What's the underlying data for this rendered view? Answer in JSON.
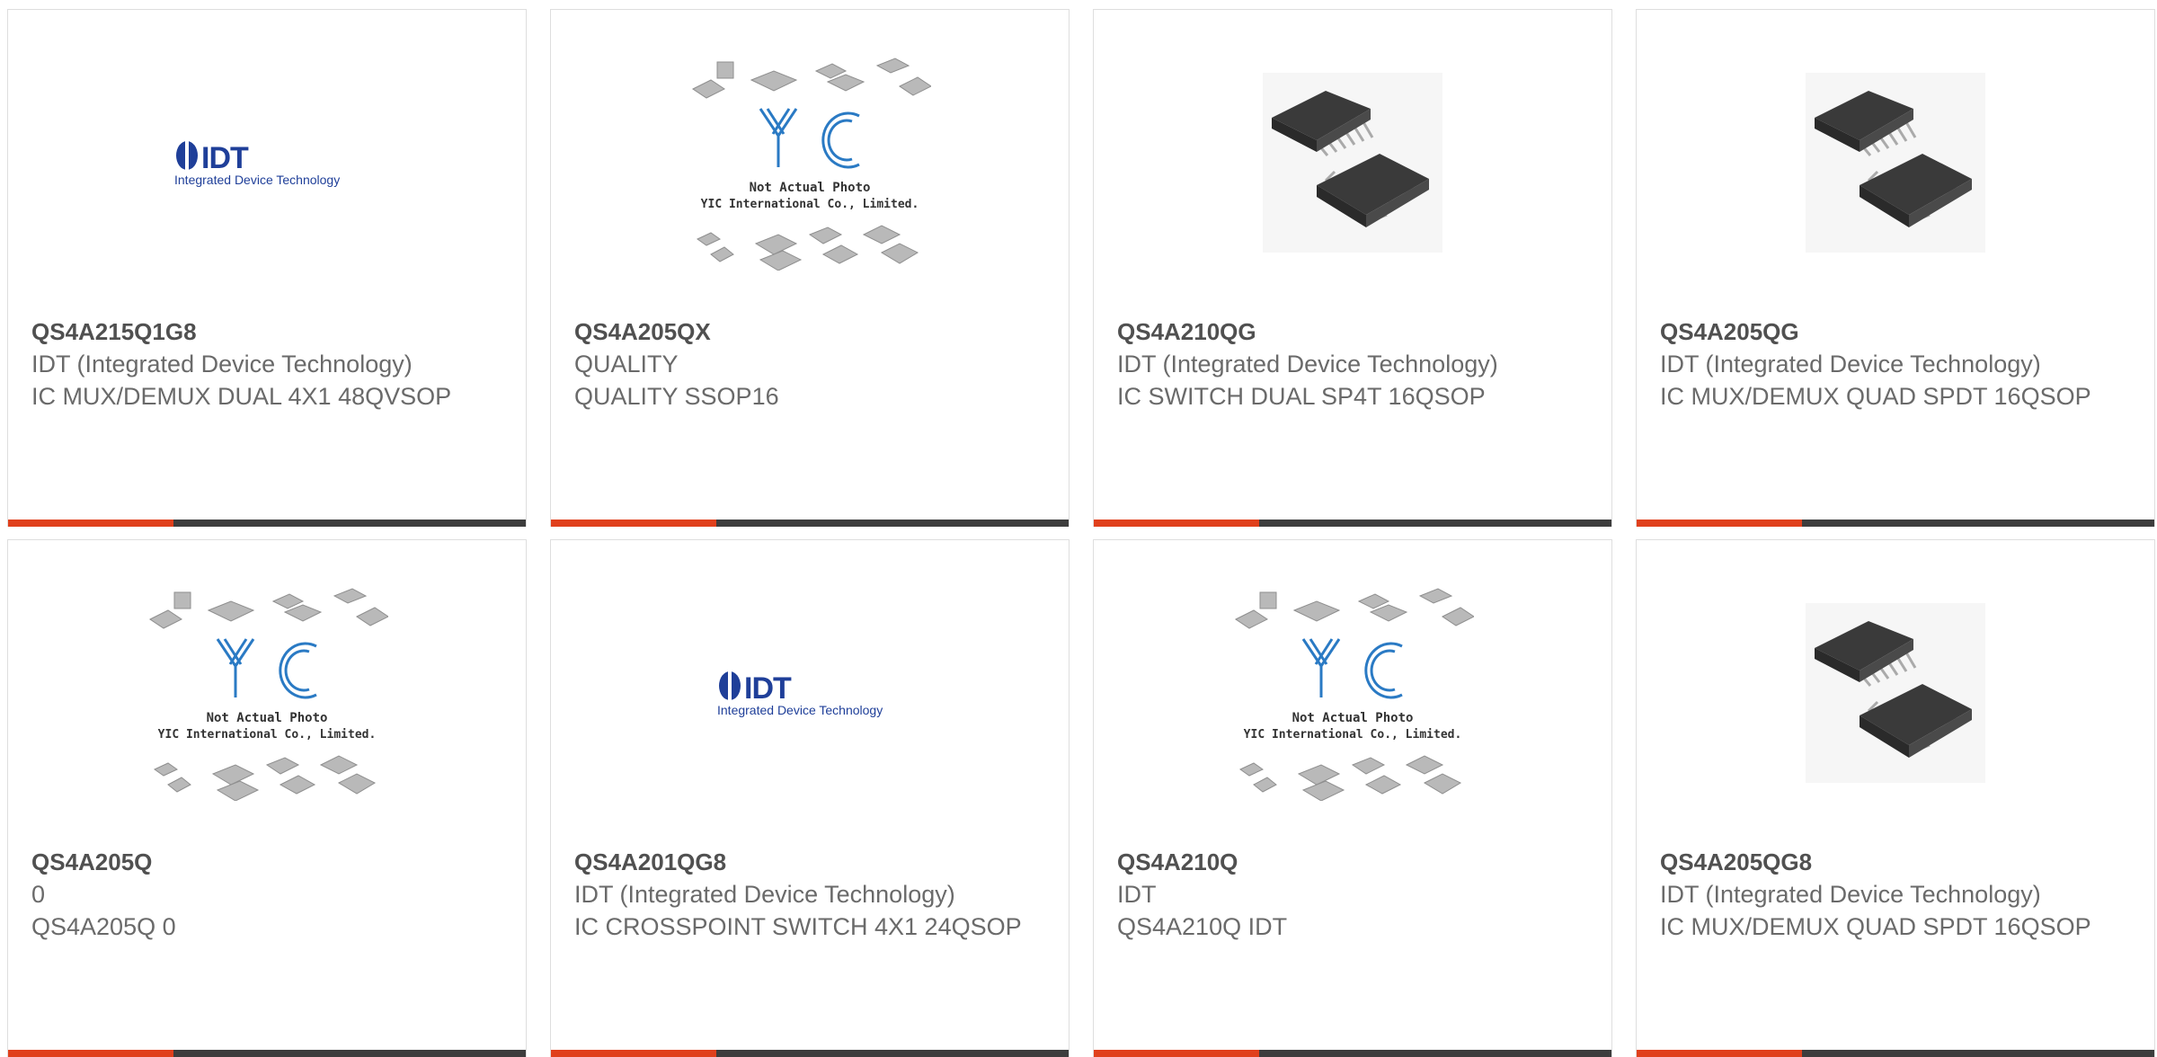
{
  "products": [
    {
      "part": "QS4A215Q1G8",
      "manufacturer": "IDT (Integrated Device Technology)",
      "description": "IC MUX/DEMUX DUAL 4X1 48QVSOP",
      "image": "idt-logo"
    },
    {
      "part": "QS4A205QX",
      "manufacturer": "QUALITY",
      "description": "QUALITY SSOP16",
      "image": "yic-placeholder"
    },
    {
      "part": "QS4A210QG",
      "manufacturer": "IDT (Integrated Device Technology)",
      "description": "IC SWITCH DUAL SP4T 16QSOP",
      "image": "ic-chip"
    },
    {
      "part": "QS4A205QG",
      "manufacturer": "IDT (Integrated Device Technology)",
      "description": "IC MUX/DEMUX QUAD SPDT 16QSOP",
      "image": "ic-chip"
    },
    {
      "part": "QS4A205Q",
      "manufacturer": "0",
      "description": "QS4A205Q 0",
      "image": "yic-placeholder"
    },
    {
      "part": "QS4A201QG8",
      "manufacturer": "IDT (Integrated Device Technology)",
      "description": "IC CROSSPOINT SWITCH 4X1 24QSOP",
      "image": "idt-logo"
    },
    {
      "part": "QS4A210Q",
      "manufacturer": "IDT",
      "description": "QS4A210Q IDT",
      "image": "yic-placeholder"
    },
    {
      "part": "QS4A205QG8",
      "manufacturer": "IDT (Integrated Device Technology)",
      "description": "IC MUX/DEMUX QUAD SPDT 16QSOP",
      "image": "ic-chip"
    }
  ],
  "logo_text": {
    "idt": "IDT",
    "idt_tagline": "Integrated Device Technology",
    "yic_line1": "Not Actual Photo",
    "yic_line2": "YIC International Co., Limited."
  },
  "colors": {
    "accent": "#e0401c",
    "bar": "#3d3d3d",
    "idt_blue": "#1f3f99",
    "yic_blue": "#2a7ac4"
  }
}
